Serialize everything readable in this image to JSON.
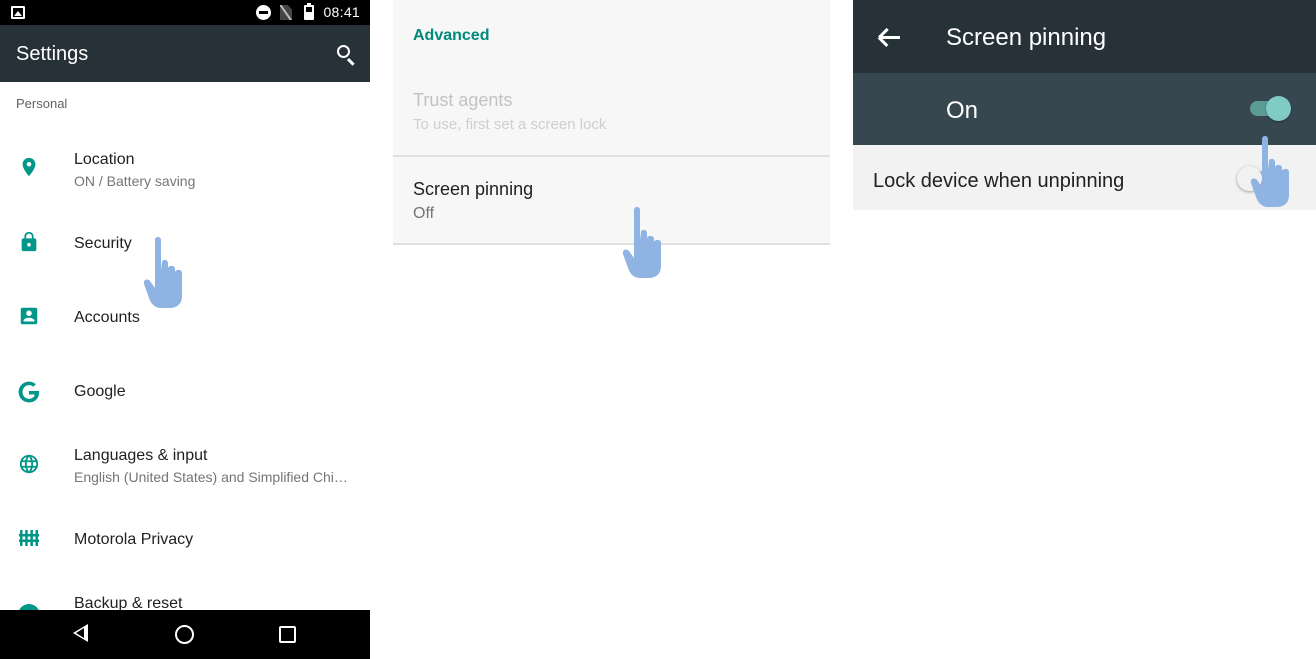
{
  "status_bar": {
    "time": "08:41"
  },
  "settings": {
    "title": "Settings",
    "section_header": "Personal",
    "items": [
      {
        "label": "Location",
        "subtitle": "ON / Battery saving",
        "icon": "location-pin-icon"
      },
      {
        "label": "Security",
        "subtitle": "",
        "icon": "lock-icon"
      },
      {
        "label": "Accounts",
        "subtitle": "",
        "icon": "account-box-icon"
      },
      {
        "label": "Google",
        "subtitle": "",
        "icon": "google-g-icon"
      },
      {
        "label": "Languages & input",
        "subtitle": "English (United States) and Simplified Chi…",
        "icon": "globe-icon"
      },
      {
        "label": "Motorola Privacy",
        "subtitle": "",
        "icon": "privacy-fence-icon"
      },
      {
        "label": "Backup & reset",
        "subtitle": "",
        "icon": "backup-icon"
      }
    ],
    "nav": {
      "back": "back-triangle-icon",
      "home": "home-circle-icon",
      "recents": "recents-square-icon"
    }
  },
  "security_advanced": {
    "section_header": "Advanced",
    "trust_agents": {
      "label": "Trust agents",
      "subtitle": "To use, first set a screen lock"
    },
    "screen_pinning": {
      "label": "Screen pinning",
      "subtitle": "Off"
    }
  },
  "screen_pinning_page": {
    "title": "Screen pinning",
    "main_toggle_label": "On",
    "main_toggle_state": true,
    "lock_option_label": "Lock device when unpinning",
    "lock_option_state": false
  },
  "colors": {
    "accent": "#009688",
    "appbar": "#263238",
    "switchbar": "#37474f",
    "hand": "#8fb4e3"
  }
}
